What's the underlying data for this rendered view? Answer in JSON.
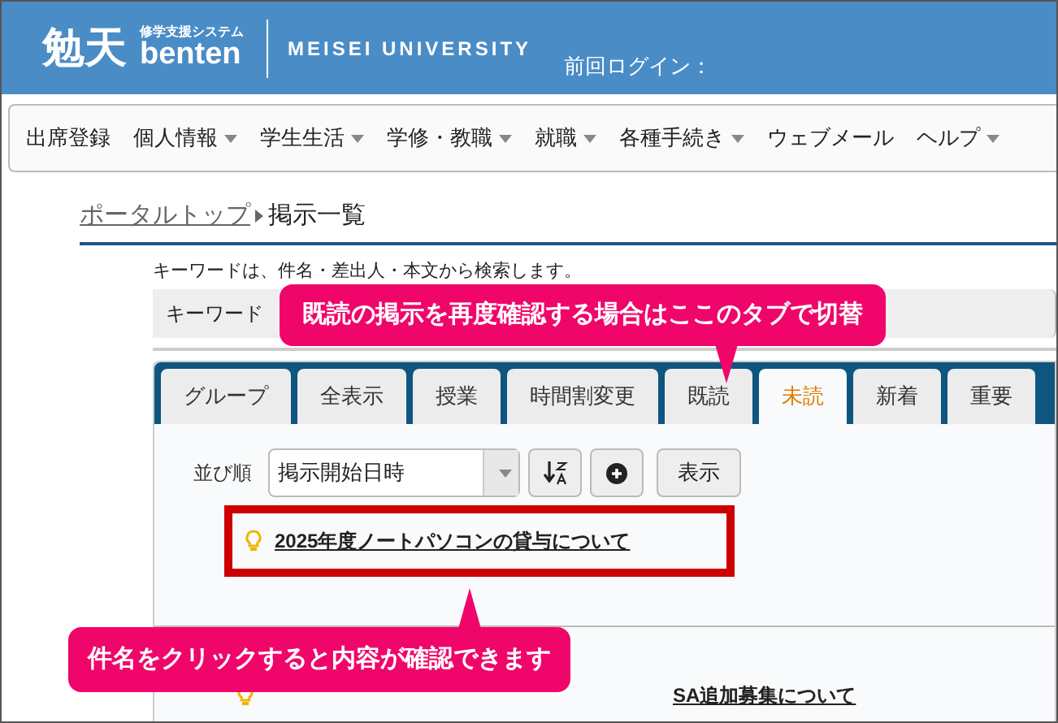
{
  "header": {
    "logo_kanji": "勉天",
    "logo_tagline": "修学支援システム",
    "logo_name": "benten",
    "university": "MEISEI UNIVERSITY",
    "last_login": "前回ログイン："
  },
  "nav": [
    {
      "label": "出席登録",
      "dropdown": false
    },
    {
      "label": "個人情報",
      "dropdown": true
    },
    {
      "label": "学生生活",
      "dropdown": true
    },
    {
      "label": "学修・教職",
      "dropdown": true
    },
    {
      "label": "就職",
      "dropdown": true
    },
    {
      "label": "各種手続き",
      "dropdown": true
    },
    {
      "label": "ウェブメール",
      "dropdown": false
    },
    {
      "label": "ヘルプ",
      "dropdown": true
    }
  ],
  "breadcrumb": {
    "link": "ポータルトップ",
    "current": "掲示一覧"
  },
  "search": {
    "hint": "キーワードは、件名・差出人・本文から検索します。",
    "label": "キーワード"
  },
  "tabs": [
    {
      "label": "グループ",
      "selected": false
    },
    {
      "label": "全表示",
      "selected": false
    },
    {
      "label": "授業",
      "selected": false
    },
    {
      "label": "時間割変更",
      "selected": false
    },
    {
      "label": "既読",
      "selected": false
    },
    {
      "label": "未読",
      "selected": true
    },
    {
      "label": "新着",
      "selected": false
    },
    {
      "label": "重要",
      "selected": false
    }
  ],
  "sort": {
    "label": "並び順",
    "value": "掲示開始日時",
    "show_button": "表示"
  },
  "notices": [
    {
      "title": "2025年度ノートパソコンの貸与について",
      "highlighted": true
    },
    {
      "title": "SA追加募集について",
      "highlighted": false
    }
  ],
  "callouts": [
    {
      "text": "既読の掲示を再度確認する場合はここのタブで切替",
      "kind": "tabs"
    },
    {
      "text": "件名をクリックすると内容が確認できます",
      "kind": "notice"
    }
  ]
}
